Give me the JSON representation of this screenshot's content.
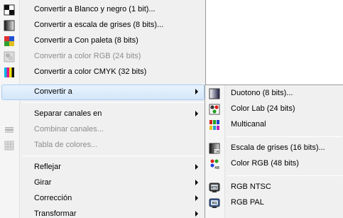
{
  "main_menu": {
    "items": [
      {
        "label": "Convertir a Blanco y negro (1 bit)...",
        "icon": "black-white-icon",
        "disabled": false
      },
      {
        "label": "Convertir a escala de grises (8 bits)...",
        "icon": "grayscale-icon",
        "disabled": false
      },
      {
        "label": "Convertir a Con paleta (8 bits)",
        "icon": "palette-icon",
        "disabled": false
      },
      {
        "label": "Convertir a color RGB (24 bits)",
        "icon": "rgb-icon",
        "disabled": true
      },
      {
        "label": "Convertir a color CMYK (32 bits)",
        "icon": "cmyk-icon",
        "disabled": false
      },
      {
        "label": "Convertir a",
        "icon": null,
        "disabled": false,
        "submenu": true,
        "highlighted": true
      },
      {
        "label": "Separar canales en",
        "icon": null,
        "disabled": false,
        "submenu": true
      },
      {
        "label": "Combinar canales...",
        "icon": "combine-channels-icon",
        "disabled": true
      },
      {
        "label": "Tabla de colores...",
        "icon": "color-table-icon",
        "disabled": true
      },
      {
        "label": "Reflejar",
        "icon": null,
        "disabled": false,
        "submenu": true
      },
      {
        "label": "Girar",
        "icon": null,
        "disabled": false,
        "submenu": true
      },
      {
        "label": "Corrección",
        "icon": null,
        "disabled": false,
        "submenu": true
      },
      {
        "label": "Transformar",
        "icon": null,
        "disabled": false,
        "submenu": true
      }
    ]
  },
  "sub_menu": {
    "items": [
      {
        "label": "Duotono (8 bits)...",
        "icon": "duotone-icon"
      },
      {
        "label": "Color Lab (24 bits)",
        "icon": "lab-color-icon"
      },
      {
        "label": "Multicanal",
        "icon": "multichannel-icon"
      },
      {
        "label": "Escala de grises (16 bits)...",
        "icon": "grayscale-16-icon"
      },
      {
        "label": "Color RGB (48 bits)",
        "icon": "rgb-48-icon"
      },
      {
        "label": "RGB NTSC",
        "icon": "ntsc-icon"
      },
      {
        "label": "RGB PAL",
        "icon": "pal-icon"
      }
    ]
  },
  "colors": {
    "menu_bg": "#f0f0f0",
    "highlight_bg": "#d3e6fa",
    "highlight_border": "#a8cdf1",
    "disabled_text": "#8d8d8d"
  }
}
